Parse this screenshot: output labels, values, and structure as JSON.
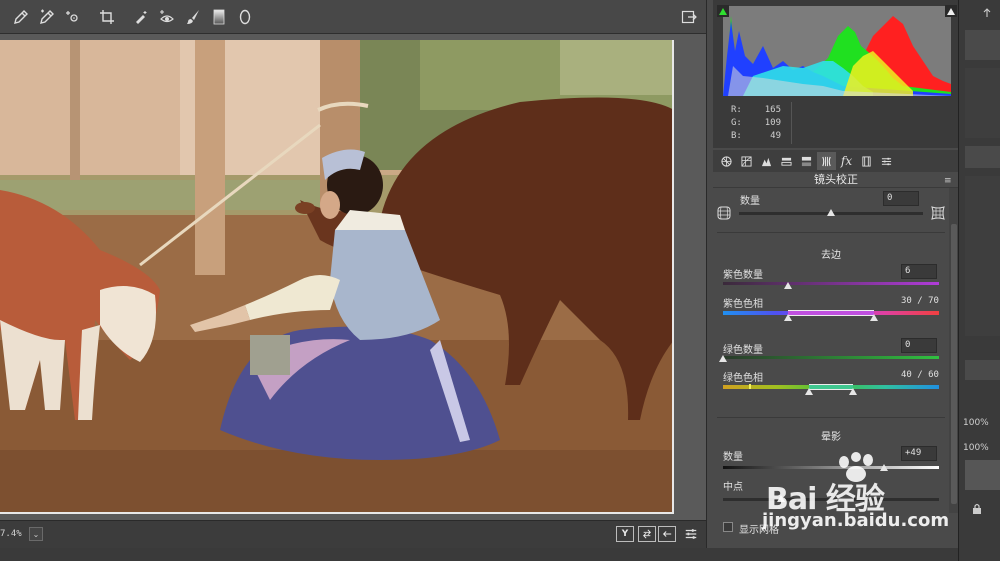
{
  "toolbar": {
    "tools": [
      "eyedropper-icon",
      "color-sampler-icon",
      "targeted-adjustment-icon",
      "crop-icon",
      "spot-removal-icon",
      "red-eye-icon",
      "adjustment-brush-icon",
      "graduated-filter-icon",
      "radial-filter-icon"
    ]
  },
  "status": {
    "zoom": "7.4%"
  },
  "histogram": {
    "rgb": {
      "r_label": "R:",
      "r_value": "165",
      "g_label": "G:",
      "g_value": "109",
      "b_label": "B:",
      "b_value": "49"
    }
  },
  "panel": {
    "title": "镜头校正",
    "amount_label": "数量",
    "amount_value": "0",
    "defringe_heading": "去边",
    "purple_amount_label": "紫色数量",
    "purple_amount_value": "6",
    "purple_hue_label": "紫色色相",
    "purple_hue_value": "30 / 70",
    "green_amount_label": "绿色数量",
    "green_amount_value": "0",
    "green_hue_label": "绿色色相",
    "green_hue_value": "40 / 60",
    "vignette_heading": "晕影",
    "vignette_amount_label": "数量",
    "vignette_amount_value": "+49",
    "midpoint_label": "中点",
    "grid_label": "显示网格"
  },
  "slider_levels": {
    "amount": 0.5,
    "purple_amount": 0.3,
    "purple_hue_low": 0.3,
    "purple_hue_high": 0.7,
    "green_amount": 0.0,
    "green_hue_low": 0.4,
    "green_hue_high": 0.6,
    "vignette_amount": 0.745,
    "midpoint": 0.27
  },
  "far_right": {
    "pct1": "100%",
    "pct2": "100%"
  },
  "watermark": {
    "logo": "Bai 经验",
    "url": "jingyan.baidu.com"
  },
  "colors": {
    "panel_bg": "#4a4a4a",
    "canvas_bg": "#5a5a5a",
    "text": "#e0e0e0",
    "purple_range": "#c050e0",
    "green_range": "#40c890"
  }
}
